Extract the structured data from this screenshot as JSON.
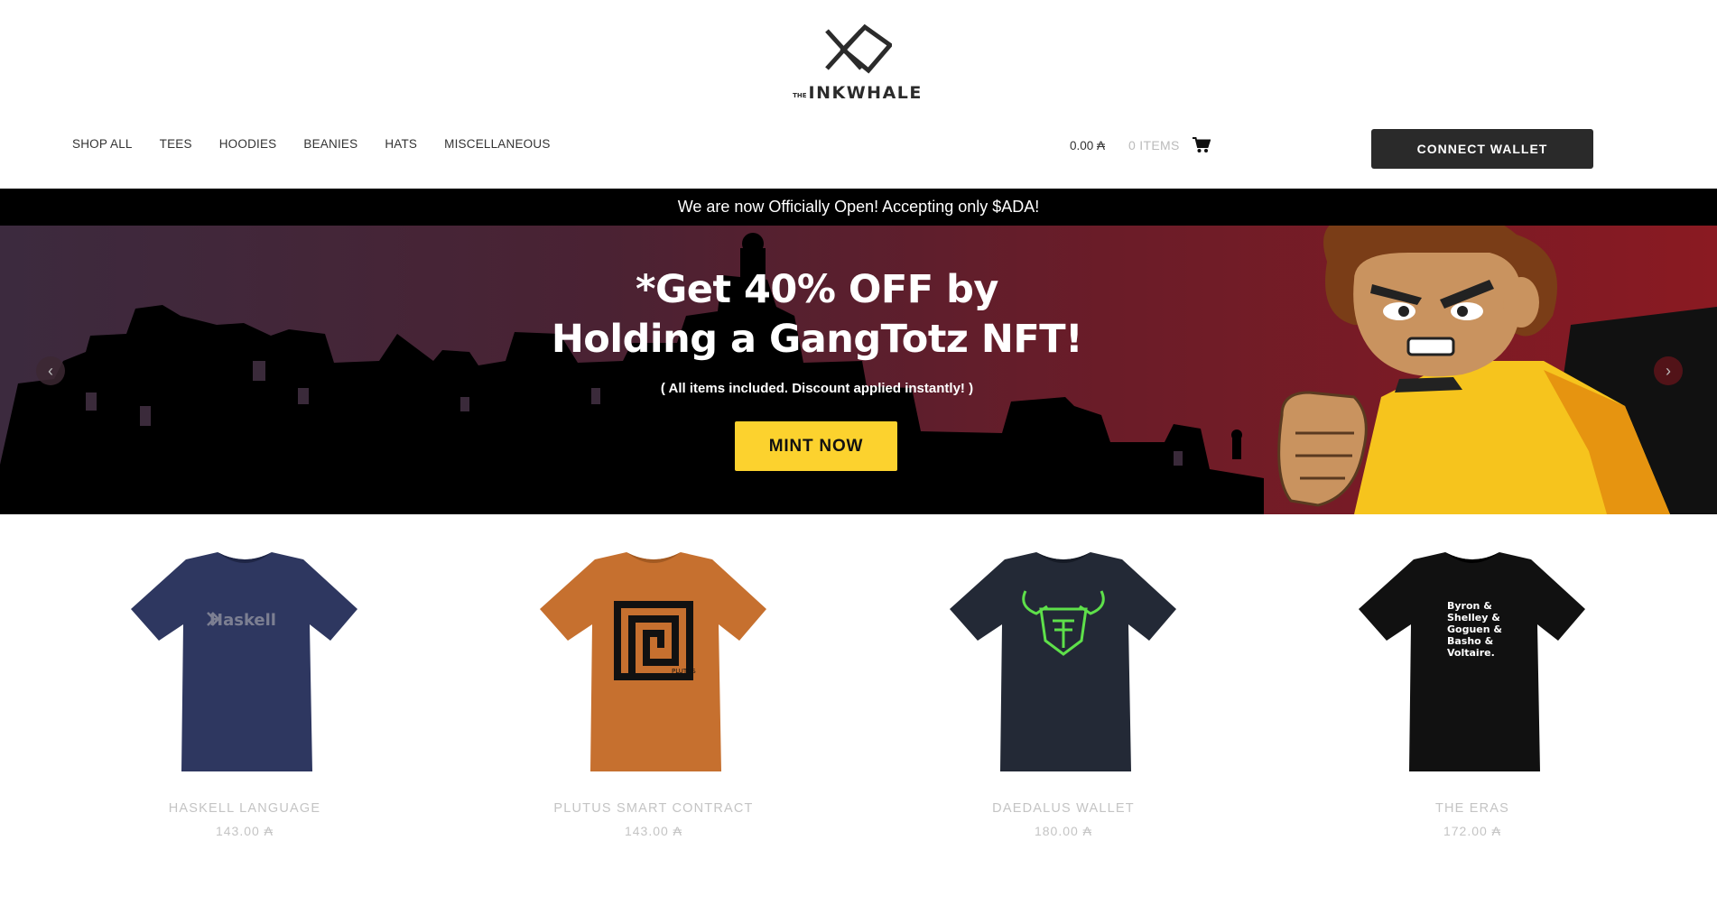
{
  "brand": {
    "small": "THE",
    "name": "INKWHALE"
  },
  "nav": [
    "SHOP ALL",
    "TEES",
    "HOODIES",
    "BEANIES",
    "HATS",
    "MISCELLANEOUS"
  ],
  "cart": {
    "total": "0.00 ₳",
    "items": "0 ITEMS"
  },
  "connect_wallet": "CONNECT WALLET",
  "announcement": "We are now Officially Open! Accepting only $ADA!",
  "hero": {
    "title_line1": "*Get 40% OFF by",
    "title_line2": "Holding a GangTotz NFT!",
    "subtitle": "( All items included. Discount applied instantly! )",
    "cta": "MINT NOW",
    "prev": "‹",
    "next": "›"
  },
  "products": [
    {
      "name": "HASKELL LANGUAGE",
      "price": "143.00 ₳",
      "shirt_color": "#2e3760",
      "print": "Haskell"
    },
    {
      "name": "PLUTUS SMART CONTRACT",
      "price": "143.00 ₳",
      "shirt_color": "#c6702f",
      "print": "PLUTUS"
    },
    {
      "name": "DAEDALUS WALLET",
      "price": "180.00 ₳",
      "shirt_color": "#232936",
      "print": ""
    },
    {
      "name": "THE ERAS",
      "price": "172.00 ₳",
      "shirt_color": "#111111",
      "print_lines": [
        "Byron &",
        "Shelley &",
        "Goguen &",
        "Basho &",
        "Voltaire."
      ]
    }
  ],
  "colors": {
    "accent": "#fcd22e",
    "button_dark": "#2a2a2a"
  }
}
